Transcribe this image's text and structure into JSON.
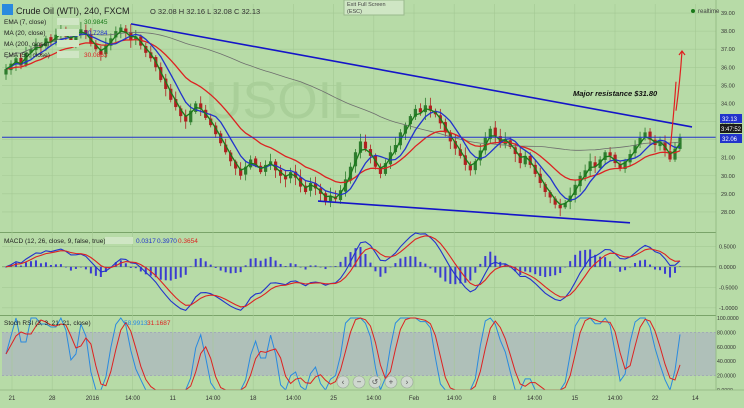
{
  "header": {
    "symbol_line": "Crude Oil (WTI), 240, FXCM",
    "ohlc": "O 32.08  H 32.16  L 32.08  C 32.13",
    "realtime": "realtime",
    "fullscreen": "Exit Full Screen",
    "esc": "(ESC)"
  },
  "indicators": [
    {
      "label": "EMA (7, close)",
      "value": "30.9845",
      "color": "#1a7a1a"
    },
    {
      "label": "MA (20, close)",
      "value": "30.7284",
      "color": "#2233cc"
    },
    {
      "label": "MA (200, close)",
      "value": "",
      "color": "#777777"
    },
    {
      "label": "EMA (50, close)",
      "value": "30.0863",
      "color": "#dd2222"
    }
  ],
  "watermark": "USOIL",
  "annotation": "Major resistance $31.80",
  "price_tags": {
    "last": "32.13",
    "timer": "3:47:52",
    "ma": "32.06"
  },
  "macd": {
    "label": "MACD (12, 26, close, 9, false, true)",
    "values": [
      "0.0317",
      "0.3970",
      "0.3654"
    ],
    "value_colors": [
      "#2233cc",
      "#2233cc",
      "#dd2222"
    ]
  },
  "stoch": {
    "label": "Stoch RSI (3, 3, 21, 21, close)",
    "values": [
      "58.9913",
      "31.1687"
    ],
    "value_colors": [
      "#2a8adf",
      "#dd2222"
    ]
  },
  "x_labels": [
    "21",
    "28",
    "2016",
    "14:00",
    "11",
    "14:00",
    "18",
    "14:00",
    "25",
    "14:00",
    "Feb",
    "14:00",
    "8",
    "14:00",
    "15",
    "14:00",
    "22",
    "14"
  ],
  "nav_icons": [
    "prev-icon",
    "zoom-out-icon",
    "reset-icon",
    "zoom-in-icon",
    "next-icon"
  ],
  "colors": {
    "bg": "#b7dba7",
    "up": "#2e7d2e",
    "down": "#b02020",
    "trend": "#1414c8",
    "ema7": "#1a7a1a",
    "ma20": "#2233cc",
    "ema50": "#dd2222",
    "ma200": "#6e6e6e"
  },
  "chart_data": [
    {
      "type": "candlestick",
      "title": "Crude Oil (WTI), 240, FXCM",
      "ylim": [
        27,
        39.5
      ],
      "y_ticks": [
        28.0,
        29.0,
        30.0,
        31.0,
        32.0,
        33.0,
        34.0,
        35.0,
        36.0,
        37.0,
        38.0,
        39.0
      ],
      "y_tick_labels": [
        "28.00",
        "29.00",
        "30.00",
        "31.00",
        "32.00",
        "33.00",
        "34.00",
        "35.00",
        "36.00",
        "37.00",
        "38.00",
        "39.00"
      ],
      "close": [
        35.9,
        36.2,
        36.5,
        36.1,
        36.8,
        37.0,
        37.3,
        37.1,
        37.6,
        37.4,
        37.8,
        38.0,
        37.7,
        37.5,
        37.9,
        38.1,
        37.8,
        37.3,
        37.0,
        36.7,
        37.2,
        37.6,
        38.0,
        38.2,
        37.9,
        37.5,
        37.7,
        37.2,
        36.8,
        36.5,
        36.0,
        35.3,
        34.8,
        34.2,
        33.8,
        33.3,
        33.0,
        33.6,
        34.0,
        33.7,
        33.2,
        32.8,
        32.3,
        31.8,
        31.3,
        30.8,
        30.4,
        30.0,
        30.5,
        30.9,
        30.6,
        30.2,
        30.6,
        30.8,
        30.3,
        30.0,
        29.8,
        30.2,
        29.9,
        29.4,
        29.1,
        29.6,
        29.3,
        29.0,
        28.6,
        28.9,
        28.7,
        29.2,
        29.8,
        30.5,
        31.3,
        31.9,
        31.5,
        31.1,
        30.5,
        30.1,
        30.7,
        31.3,
        31.7,
        32.4,
        32.8,
        33.3,
        33.7,
        33.5,
        33.9,
        33.6,
        33.4,
        32.9,
        32.4,
        31.9,
        31.5,
        31.1,
        30.6,
        30.3,
        30.8,
        31.4,
        32.1,
        32.6,
        32.2,
        31.8,
        32.0,
        31.6,
        31.2,
        30.7,
        31.1,
        30.6,
        30.1,
        29.6,
        29.1,
        28.8,
        28.4,
        28.2,
        28.5,
        28.9,
        29.5,
        30.0,
        30.3,
        30.8,
        30.5,
        30.9,
        31.3,
        31.1,
        30.7,
        30.4,
        30.8,
        31.2,
        31.7,
        32.1,
        32.4,
        32.0,
        31.7,
        31.9,
        31.4,
        30.9,
        31.5,
        32.13
      ]
    },
    {
      "type": "macd",
      "series_names": [
        "MACD",
        "Signal",
        "Histogram"
      ],
      "ylim": [
        -1.15,
        0.75
      ],
      "y_ticks": [
        0.5,
        0.0,
        -0.5,
        -1.0
      ],
      "y_tick_labels": [
        "0.5000",
        "0.0000",
        "-0.5000",
        "-1.0000"
      ]
    },
    {
      "type": "stochastic_rsi",
      "series_names": [
        "%K",
        "%D"
      ],
      "ylim": [
        0,
        100
      ],
      "y_ticks": [
        100,
        80,
        60,
        40,
        20,
        0
      ],
      "y_tick_labels": [
        "100.0000",
        "80.0000",
        "60.0000",
        "40.0000",
        "20.0000",
        "0.0000"
      ],
      "band": [
        20,
        80
      ]
    }
  ]
}
